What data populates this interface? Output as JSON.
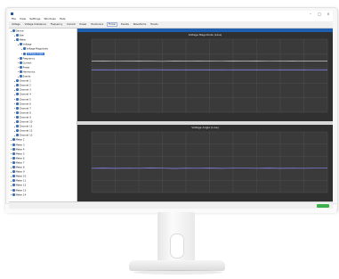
{
  "window": {
    "title": "",
    "controls": [
      "min",
      "max",
      "close"
    ]
  },
  "menu": [
    "File",
    "View",
    "Settings",
    "Windows",
    "Help"
  ],
  "toolbar": [
    "Voltage",
    "Voltage Unbalance",
    "Frequency",
    "Current",
    "Power",
    "Harmonics",
    "Flicker",
    "Events",
    "Waveforms",
    "Trends"
  ],
  "tree": {
    "items": [
      "Device",
      "Site",
      "Meter",
      "Voltage",
      "Voltage Magnitude",
      "Voltage Angle",
      "Frequency",
      "Current",
      "Power",
      "Harmonics",
      "Events",
      "Channel 1",
      "Channel 2",
      "Channel 3",
      "Channel 4",
      "Channel 5",
      "Channel 6",
      "Channel 7",
      "Channel 8",
      "Channel 9",
      "Channel 10",
      "Channel 11",
      "Channel 12",
      "Channel 13",
      "Meter 2",
      "Meter 3",
      "Meter 4",
      "Meter 5",
      "Meter 6",
      "Meter 7",
      "Meter 8",
      "Meter 9",
      "Meter 10",
      "Meter 11",
      "Meter 12",
      "Meter 13",
      "Meter 14"
    ]
  },
  "pane": {
    "strip_text": ""
  },
  "charts": {
    "top": {
      "title": "Voltage Magnitude (Line)"
    },
    "bottom": {
      "title": "Voltage Angle (Line)"
    }
  },
  "chart_data": [
    {
      "type": "line",
      "title": "Voltage Magnitude (Line)",
      "xlabel": "",
      "ylabel": "",
      "series": [
        {
          "values": [
            58,
            58.2,
            57.9,
            58.1,
            58,
            58.3,
            58.1,
            57.8,
            58.2,
            58,
            58.1,
            57.9,
            58.2,
            58.1,
            58,
            58.2,
            57.9,
            58.1,
            58,
            58.2,
            58.1
          ]
        },
        {
          "values": [
            70,
            70.1,
            69.9,
            70,
            70.2,
            70,
            69.8,
            70.1,
            70,
            70.2,
            70,
            69.9,
            70.1,
            70,
            70.1,
            69.9,
            70,
            70.2,
            70,
            70.1,
            70
          ]
        }
      ],
      "ylim": [
        0,
        100
      ],
      "grid": true
    },
    {
      "type": "line",
      "title": "Voltage Angle (Line)",
      "xlabel": "",
      "ylabel": "",
      "series": [
        {
          "values": [
            40,
            40.3,
            39.8,
            40.2,
            40,
            40.4,
            40.1,
            39.7,
            40.2,
            40,
            40.3,
            39.9,
            40.2,
            40.1,
            40,
            40.3,
            39.8,
            40.1,
            40,
            40.2,
            40.1
          ]
        }
      ],
      "ylim": [
        0,
        100
      ],
      "grid": true
    }
  ],
  "statusbar": {
    "left": "",
    "badge": ""
  },
  "colors": {
    "accent": "#1f5fb0",
    "plot_bg": "#303030",
    "line1": "#8c8cff",
    "line2": "#c8c8c8",
    "badge": "#3cb04a"
  }
}
